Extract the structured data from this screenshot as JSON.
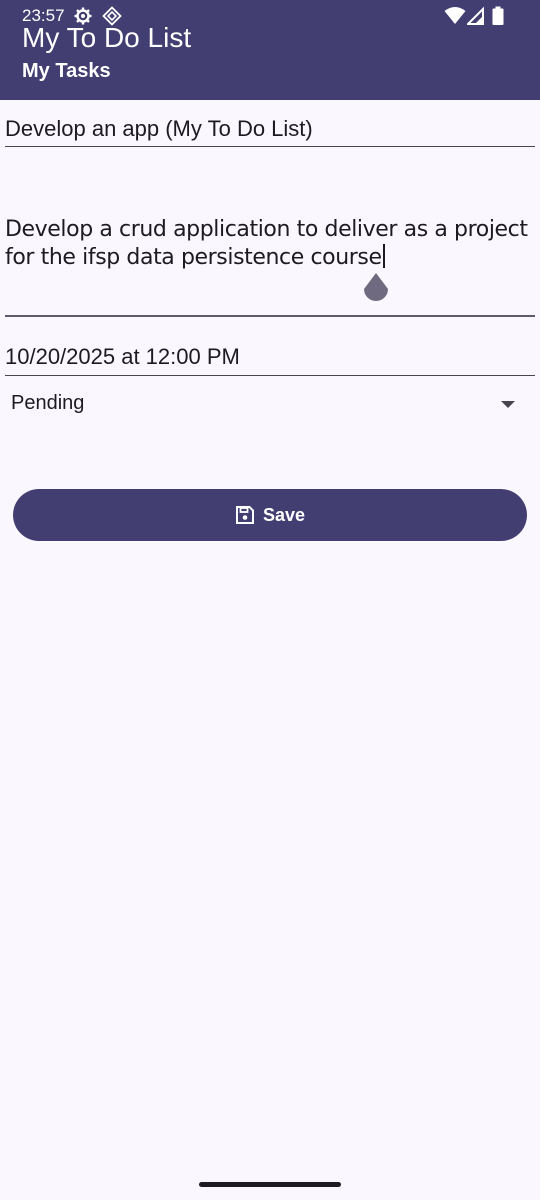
{
  "status_bar": {
    "time": "23:57",
    "icons": [
      "settings-gear-icon",
      "diamond-app-icon",
      "wifi-icon",
      "cellular-signal-icon",
      "battery-icon"
    ]
  },
  "app_bar": {
    "title": "My To Do List",
    "subtitle": "My Tasks",
    "background_color": "#433e72"
  },
  "form": {
    "title_value": "Develop an app (My To Do List)",
    "description_value": "Develop a crud application to deliver as a project for the ifsp data persistence course",
    "due_date_value": "10/20/2025 at 12:00 PM",
    "status": {
      "selected": "Pending"
    },
    "save_button": {
      "label": "Save",
      "icon": "save-floppy-icon"
    }
  },
  "colors": {
    "primary": "#433e72",
    "background": "#faf7fe",
    "text": "#1c1b1f"
  }
}
